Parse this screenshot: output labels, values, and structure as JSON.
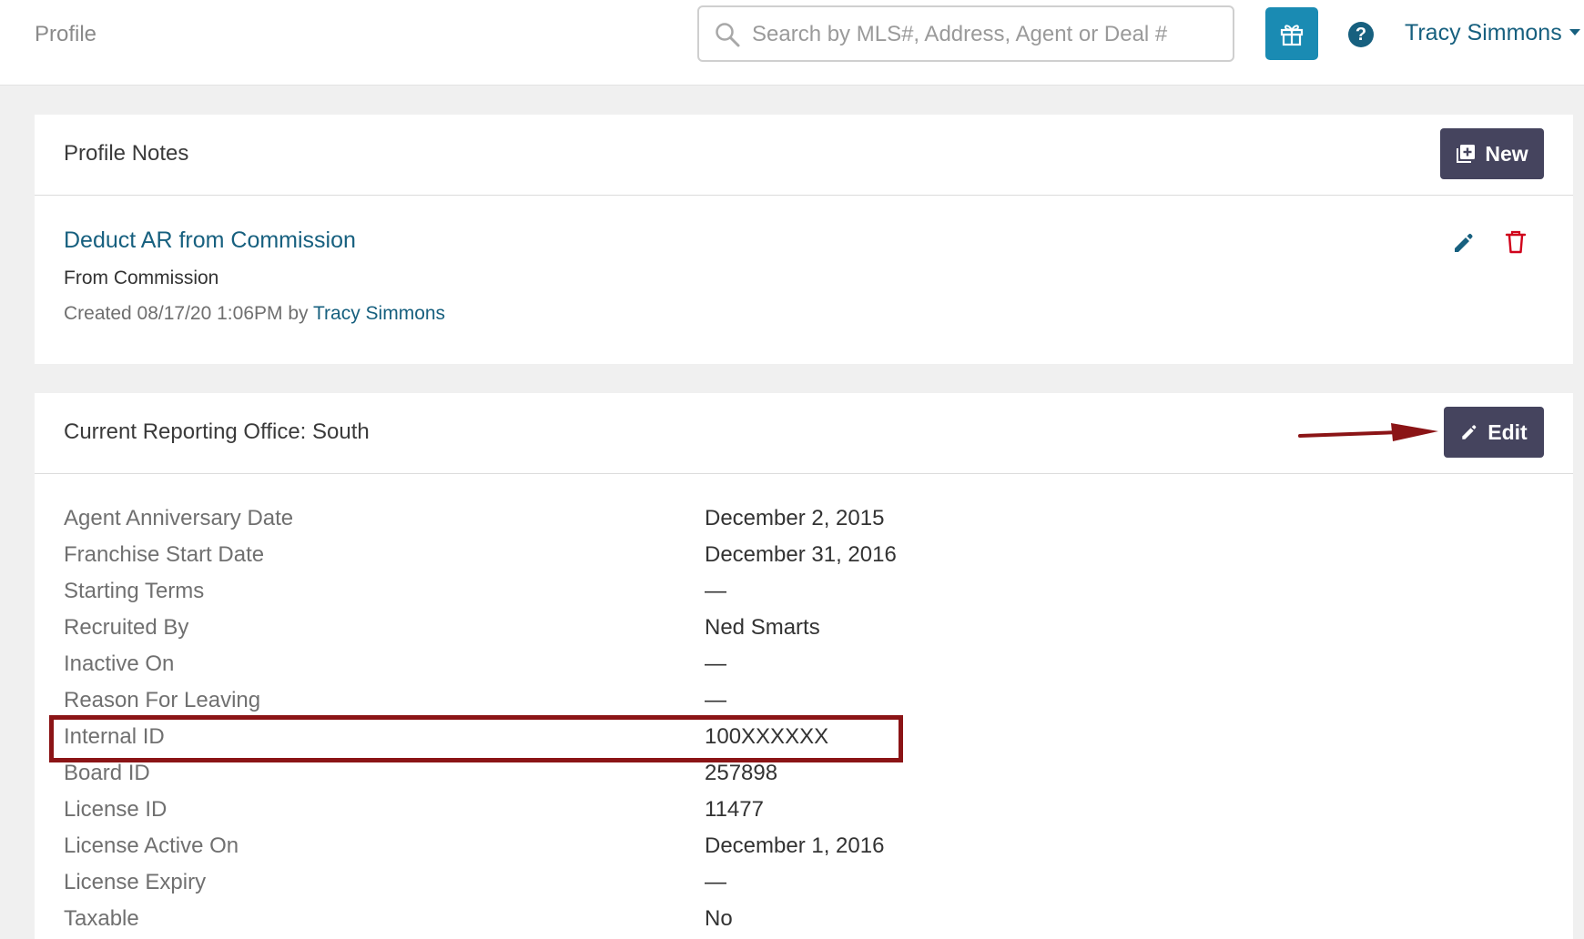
{
  "header": {
    "title": "Profile",
    "search_placeholder": "Search by MLS#, Address, Agent or Deal #",
    "gift_icon": "gift-icon",
    "help_label": "?",
    "user_name": "Tracy Simmons"
  },
  "notes_card": {
    "title": "Profile Notes",
    "new_button_label": "New",
    "note": {
      "title": "Deduct AR from Commission",
      "subtitle": "From Commission",
      "created_text": "Created 08/17/20 1:06PM by",
      "author": "Tracy Simmons"
    }
  },
  "office_card": {
    "title": "Current Reporting Office: South",
    "edit_button_label": "Edit",
    "rows": [
      {
        "label": "Agent Anniversary Date",
        "value": "December 2, 2015"
      },
      {
        "label": "Franchise Start Date",
        "value": "December 31, 2016"
      },
      {
        "label": "Starting Terms",
        "value": "—"
      },
      {
        "label": "Recruited By",
        "value": "Ned Smarts"
      },
      {
        "label": "Inactive On",
        "value": "—"
      },
      {
        "label": "Reason For Leaving",
        "value": "—"
      },
      {
        "label": "Internal ID",
        "value": "100XXXXXX"
      },
      {
        "label": "Board ID",
        "value": "257898"
      },
      {
        "label": "License ID",
        "value": "11477"
      },
      {
        "label": "License Active On",
        "value": "December 1, 2016"
      },
      {
        "label": "License Expiry",
        "value": "—"
      },
      {
        "label": "Taxable",
        "value": "No"
      }
    ]
  },
  "annotations": {
    "arrow_color": "#8b1416",
    "highlight_color": "#8b1416"
  },
  "colors": {
    "accent_link": "#17607f",
    "gift_button": "#1a8bb3",
    "dark_button": "#45445e",
    "delete_icon": "#d0021b"
  }
}
